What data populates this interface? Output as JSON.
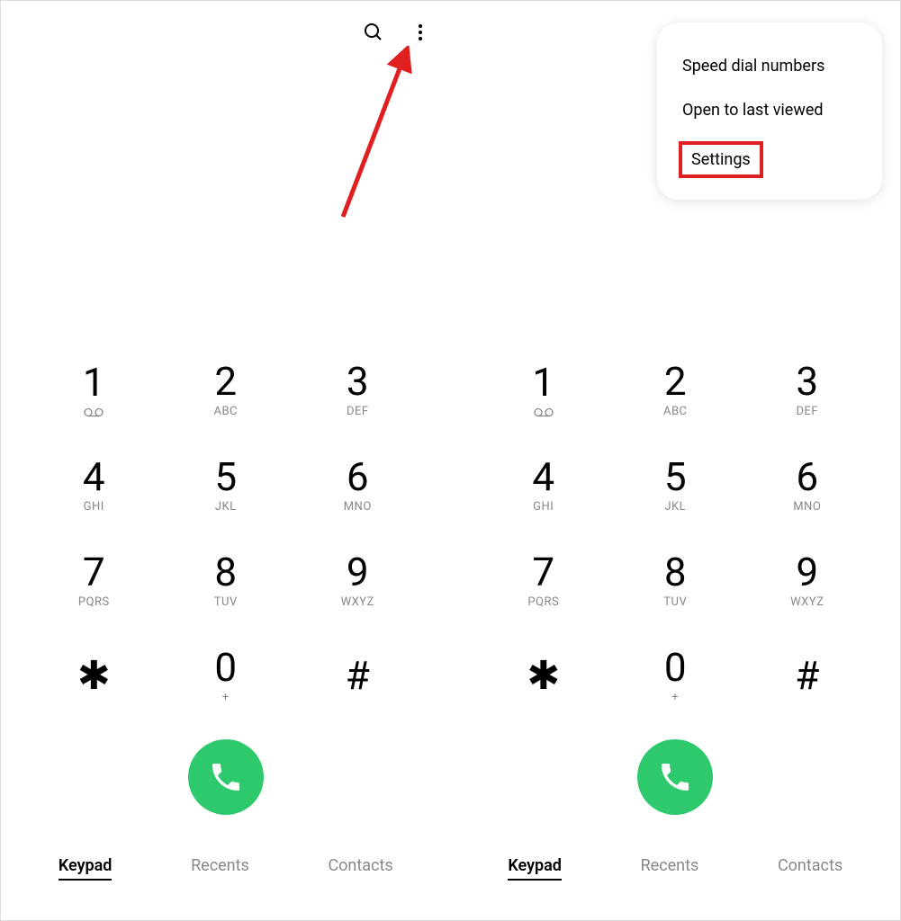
{
  "keypad": {
    "keys": [
      {
        "digit": "1",
        "letters": ""
      },
      {
        "digit": "2",
        "letters": "ABC"
      },
      {
        "digit": "3",
        "letters": "DEF"
      },
      {
        "digit": "4",
        "letters": "GHI"
      },
      {
        "digit": "5",
        "letters": "JKL"
      },
      {
        "digit": "6",
        "letters": "MNO"
      },
      {
        "digit": "7",
        "letters": "PQRS"
      },
      {
        "digit": "8",
        "letters": "TUV"
      },
      {
        "digit": "9",
        "letters": "WXYZ"
      },
      {
        "digit": "✱",
        "letters": ""
      },
      {
        "digit": "0",
        "letters": "+"
      },
      {
        "digit": "#",
        "letters": ""
      }
    ]
  },
  "nav": {
    "items": [
      {
        "label": "Keypad",
        "active": true
      },
      {
        "label": "Recents",
        "active": false
      },
      {
        "label": "Contacts",
        "active": false
      }
    ]
  },
  "menu": {
    "items": [
      {
        "label": "Speed dial numbers"
      },
      {
        "label": "Open to last viewed"
      },
      {
        "label": "Settings"
      }
    ]
  },
  "colors": {
    "call_button": "#2dc96c",
    "highlight": "#e02020",
    "arrow": "#e02020"
  }
}
